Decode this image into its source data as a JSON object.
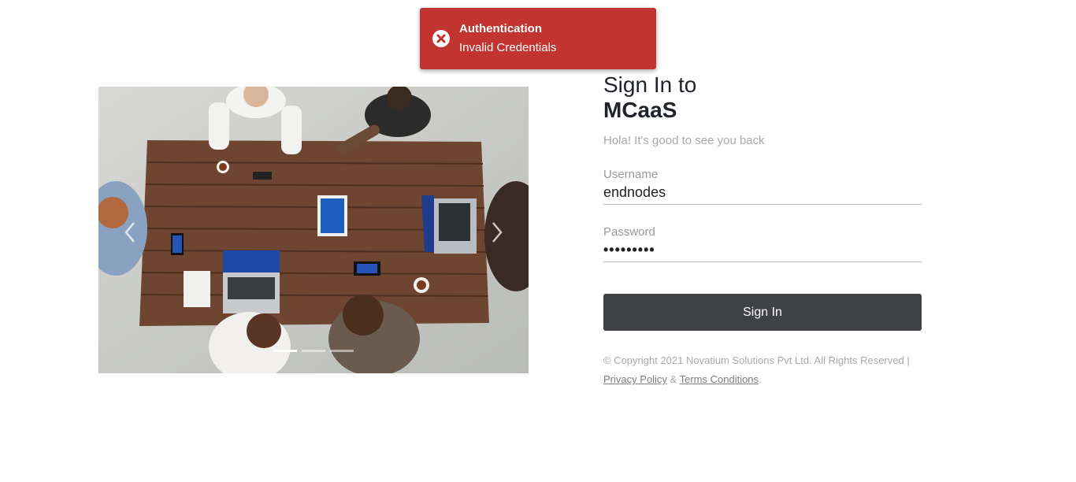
{
  "toast": {
    "title": "Authentication",
    "message": "Invalid Credentials",
    "icon": "error-circle-icon",
    "color": "#c1342f"
  },
  "carousel": {
    "prev_icon": "chevron-left-icon",
    "next_icon": "chevron-right-icon",
    "slide_count": 3,
    "active_index": 0
  },
  "login": {
    "title_line1": "Sign In to",
    "title_line2": "MCaaS",
    "subtitle": "Hola! It's good to see you back",
    "username_label": "Username",
    "username_value": "endnodes",
    "password_label": "Password",
    "password_value": "•••••••••",
    "signin_label": "Sign In",
    "button_color": "#404145"
  },
  "footer": {
    "copyright": "© Copyright 2021 Novatium Solutions Pvt Ltd. All Rights Reserved |",
    "privacy_link": "Privacy Policy",
    "separator": "&",
    "terms_link": "Terms Conditions",
    "end": "."
  }
}
